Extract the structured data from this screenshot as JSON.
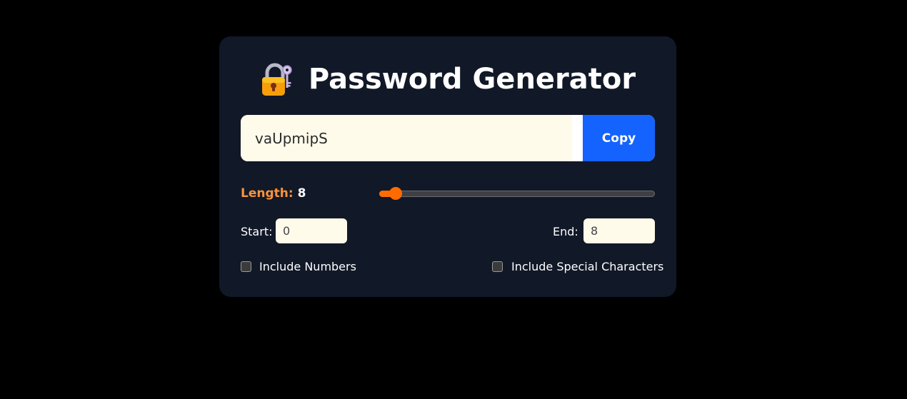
{
  "app": {
    "title": "Password Generator",
    "icon": "locked-with-key-icon"
  },
  "password": {
    "value": "vaUpmipS",
    "copy_label": "Copy"
  },
  "length": {
    "label": "Length:",
    "value": "8",
    "slider_fraction": 0.04
  },
  "range": {
    "start_label": "Start:",
    "start_value": "0",
    "end_label": "End:",
    "end_value": "8"
  },
  "options": {
    "numbers_label": "Include Numbers",
    "numbers_checked": false,
    "special_label": "Include Special Characters",
    "special_checked": false
  },
  "colors": {
    "page_background": "#000000",
    "card_background": "#111827",
    "accent_orange": "#ff6b00",
    "label_orange": "#fb923c",
    "copy_button_blue": "#1463ff",
    "input_background": "#fffbea"
  }
}
